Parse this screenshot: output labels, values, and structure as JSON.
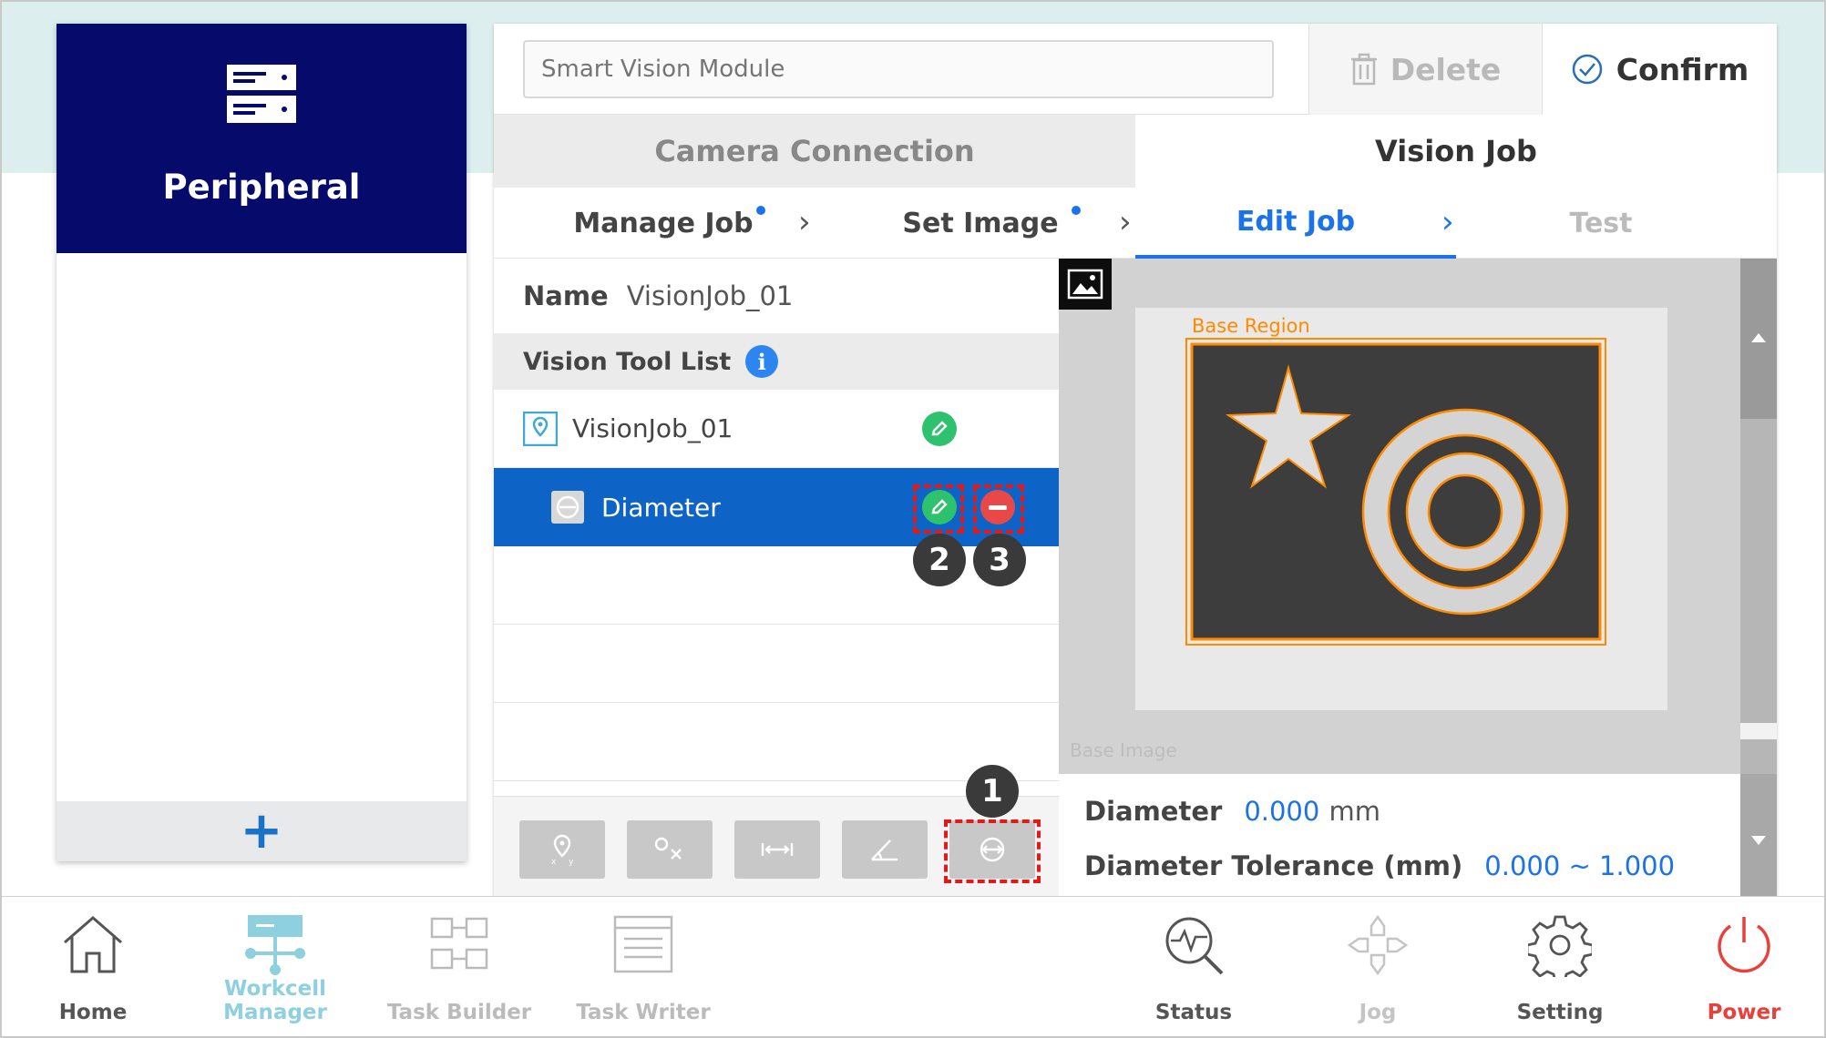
{
  "sidebar": {
    "title": "Peripheral",
    "add_label": "+"
  },
  "top_bar": {
    "module_placeholder": "Smart Vision Module",
    "delete_label": "Delete",
    "confirm_label": "Confirm"
  },
  "tabs": {
    "camera_connection": "Camera Connection",
    "vision_job": "Vision Job"
  },
  "steps": {
    "manage_job": "Manage Job",
    "set_image": "Set Image",
    "edit_job": "Edit Job",
    "test": "Test"
  },
  "job": {
    "name_label": "Name",
    "name_value": "VisionJob_01",
    "tool_list_label": "Vision Tool List",
    "info_glyph": "i",
    "rows": [
      {
        "label": "VisionJob_01"
      },
      {
        "label": "Diameter"
      }
    ]
  },
  "callouts": [
    "1",
    "2",
    "3"
  ],
  "image": {
    "region_label": "Base Region",
    "base_image_label": "Base Image"
  },
  "results": {
    "diameter_label": "Diameter",
    "diameter_value": "0.000",
    "diameter_unit": "mm",
    "tolerance_label": "Diameter Tolerance (mm)",
    "tolerance_value": "0.000 ~ 1.000"
  },
  "nav": {
    "home": "Home",
    "workcell_manager": "Workcell Manager",
    "task_builder": "Task Builder",
    "task_writer": "Task Writer",
    "status": "Status",
    "jog": "Jog",
    "setting": "Setting",
    "power": "Power"
  },
  "colors": {
    "sidebar_header": "#060a6b",
    "accent_blue": "#1a73e8",
    "selected_row": "#0d63c6",
    "edit_green": "#2fc26e",
    "delete_red": "#e84848",
    "region_orange": "#ff8a00",
    "workcell_active": "#8ed0e0",
    "power_red": "#e8413c"
  }
}
